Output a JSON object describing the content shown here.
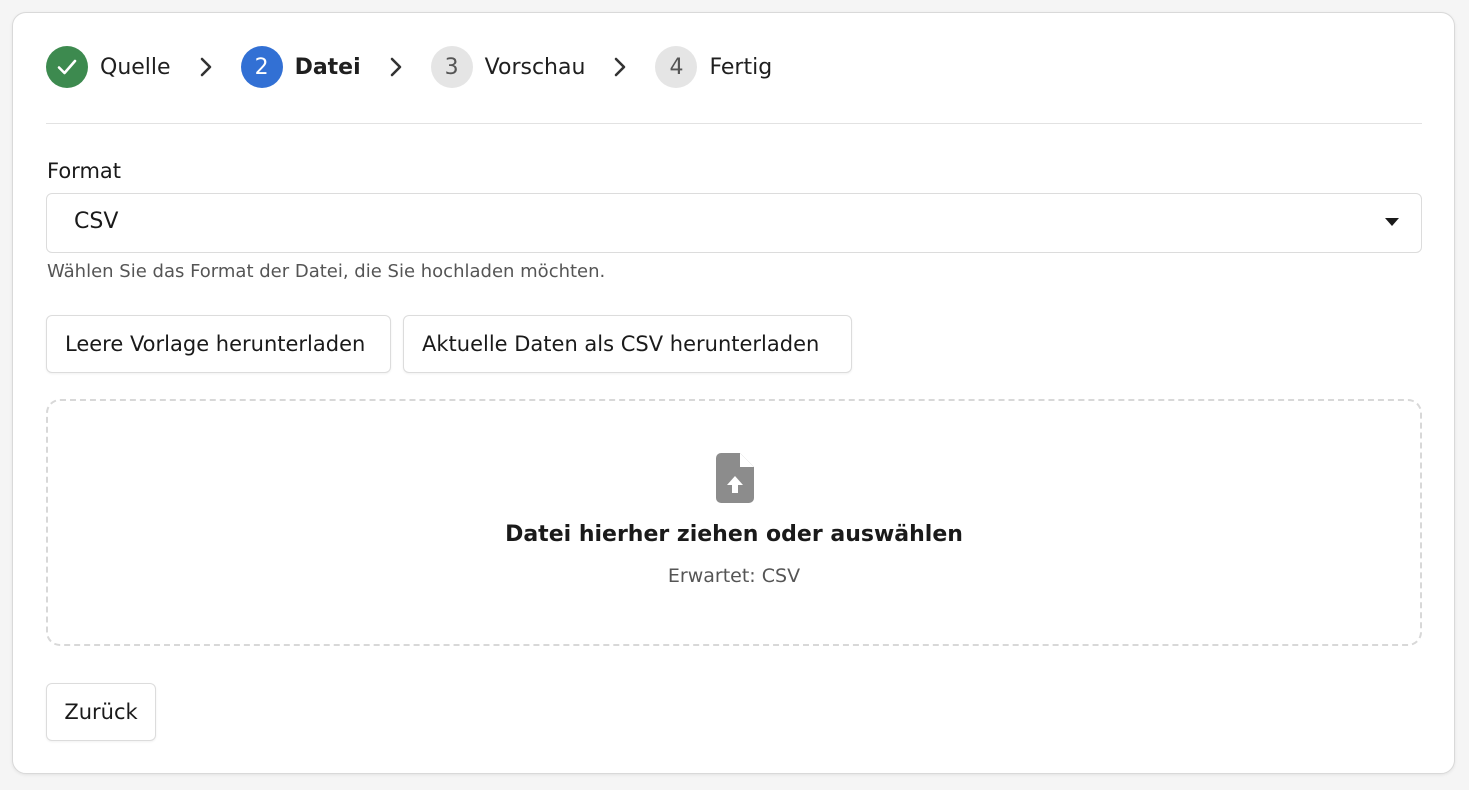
{
  "stepper": {
    "steps": [
      {
        "number": "",
        "label": "Quelle",
        "state": "done"
      },
      {
        "number": "2",
        "label": "Datei",
        "state": "active"
      },
      {
        "number": "3",
        "label": "Vorschau",
        "state": "pending"
      },
      {
        "number": "4",
        "label": "Fertig",
        "state": "pending"
      }
    ]
  },
  "format": {
    "label": "Format",
    "selected": "CSV",
    "help": "Wählen Sie das Format der Datei, die Sie hochladen möchten."
  },
  "actions": {
    "template_label": "Leere Vorlage herunterladen",
    "export_label": "Aktuelle Daten als CSV herunterladen"
  },
  "dropzone": {
    "title": "Datei hierher ziehen oder auswählen",
    "subtitle": "Erwartet: CSV"
  },
  "footer": {
    "back_label": "Zurück"
  },
  "colors": {
    "done": "#3d8a4f",
    "active": "#3270d4",
    "pending": "#e5e5e5"
  }
}
